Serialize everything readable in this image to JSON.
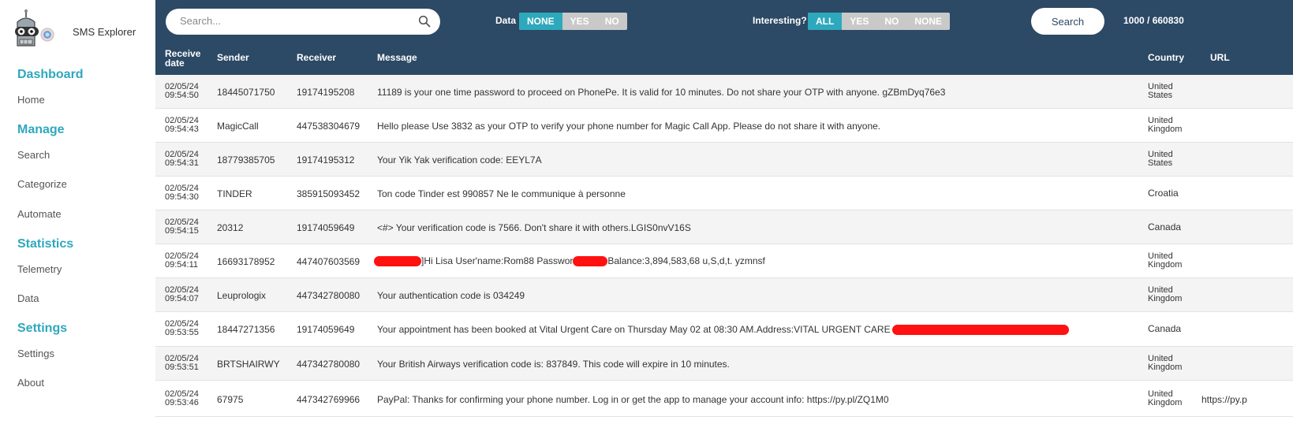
{
  "app": {
    "name": "SMS Explorer",
    "logo_icon": "robot-logo-icon"
  },
  "sidebar": {
    "sections": [
      {
        "title": "Dashboard",
        "items": [
          "Home"
        ]
      },
      {
        "title": "Manage",
        "items": [
          "Search",
          "Categorize",
          "Automate"
        ]
      },
      {
        "title": "Statistics",
        "items": [
          "Telemetry",
          "Data"
        ]
      },
      {
        "title": "Settings",
        "items": [
          "Settings",
          "About"
        ]
      }
    ]
  },
  "topbar": {
    "search_placeholder": "Search...",
    "search_icon": "magnifier-icon",
    "data_filter": {
      "label": "Data",
      "options": [
        "NONE",
        "YES",
        "NO"
      ],
      "selected": "NONE"
    },
    "interesting_filter": {
      "label": "Interesting?",
      "options": [
        "ALL",
        "YES",
        "NO",
        "NONE"
      ],
      "selected": "ALL"
    },
    "search_button": "Search",
    "count": "1000 / 660830"
  },
  "colors": {
    "header_bg": "#2c4965",
    "accent": "#2ea8bc",
    "inactive_seg": "#c9c9c9",
    "redaction": "#ff1111"
  },
  "table": {
    "columns": [
      "Receive date",
      "Sender",
      "Receiver",
      "Message",
      "Country",
      "URL"
    ],
    "rows": [
      {
        "date": "02/05/24",
        "time": "09:54:50",
        "sender": "18445071750",
        "receiver": "19174195208",
        "message": "11189 is your one time password to proceed on PhonePe. It is valid for 10 minutes. Do not share your OTP with anyone. gZBmDyq76e3",
        "country_1": "United",
        "country_2": "States",
        "url": ""
      },
      {
        "date": "02/05/24",
        "time": "09:54:43",
        "sender": "MagicCall",
        "receiver": "447538304679",
        "message": "Hello please Use 3832 as your OTP to verify your phone number for Magic Call App. Please do not share it with anyone.",
        "country_1": "United",
        "country_2": "Kingdom",
        "url": ""
      },
      {
        "date": "02/05/24",
        "time": "09:54:31",
        "sender": "18779385705",
        "receiver": "19174195312",
        "message": "Your Yik Yak verification code: EEYL7A",
        "country_1": "United",
        "country_2": "States",
        "url": ""
      },
      {
        "date": "02/05/24",
        "time": "09:54:30",
        "sender": "TINDER",
        "receiver": "385915093452",
        "message": "Ton code Tinder est 990857 Ne le communique à personne",
        "country_1": "Croatia",
        "country_2": "",
        "url": ""
      },
      {
        "date": "02/05/24",
        "time": "09:54:15",
        "sender": "20312",
        "receiver": "19174059649",
        "message": "<#> Your verification code is 7566. Don't share it with others.LGIS0nvV16S",
        "country_1": "Canada",
        "country_2": "",
        "url": ""
      },
      {
        "date": "02/05/24",
        "time": "09:54:11",
        "sender": "16693178952",
        "receiver": "447407603569",
        "message_a": "]Hi Lisa User'name:Rom88 Password:",
        "message_b": "Balance:3,894,583,68 u,S,d,t. yzmnsf",
        "country_1": "United",
        "country_2": "Kingdom",
        "url": ""
      },
      {
        "date": "02/05/24",
        "time": "09:54:07",
        "sender": "Leuprologix",
        "receiver": "447342780080",
        "message": "Your authentication code is 034249",
        "country_1": "United",
        "country_2": "Kingdom",
        "url": ""
      },
      {
        "date": "02/05/24",
        "time": "09:53:55",
        "sender": "18447271356",
        "receiver": "19174059649",
        "message": "Your appointment has been booked at Vital Urgent Care on Thursday May 02 at 08:30 AM.Address:VITAL URGENT CARE",
        "country_1": "Canada",
        "country_2": "",
        "url": ""
      },
      {
        "date": "02/05/24",
        "time": "09:53:51",
        "sender": "BRTSHAIRWY",
        "receiver": "447342780080",
        "message": "Your British Airways verification code is: 837849. This code will expire in 10 minutes.",
        "country_1": "United",
        "country_2": "Kingdom",
        "url": ""
      },
      {
        "date": "02/05/24",
        "time": "09:53:46",
        "sender": "67975",
        "receiver": "447342769966",
        "message": "PayPal: Thanks for confirming your phone number. Log in or get the app to manage your account info: https://py.pl/ZQ1M0",
        "country_1": "United",
        "country_2": "Kingdom",
        "url": "https://py.p"
      }
    ]
  }
}
